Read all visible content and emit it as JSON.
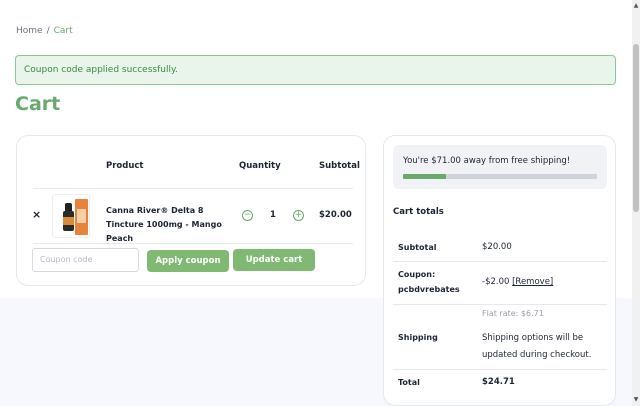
{
  "breadcrumb": {
    "home": "Home",
    "separator": "/",
    "current": "Cart"
  },
  "notice": {
    "message": "Coupon code applied successfully."
  },
  "page_title": "Cart",
  "cart": {
    "headers": {
      "product": "Product",
      "quantity": "Quantity",
      "subtotal": "Subtotal"
    },
    "item": {
      "remove": "×",
      "name": "Canna River® Delta 8 Tincture 1000mg - Mango Peach",
      "qty_minus": "−",
      "quantity": "1",
      "qty_plus": "+",
      "subtotal": "$20.00"
    },
    "coupon_placeholder": "Coupon code",
    "apply_coupon_label": "Apply coupon",
    "update_cart_label": "Update cart"
  },
  "totals": {
    "free_shipping_message": "You're $71.00 away from free shipping!",
    "free_shipping_progress": 0.22,
    "title": "Cart totals",
    "subtotal_label": "Subtotal",
    "subtotal_value": "$20.00",
    "coupon_label": "Coupon: pcbdvrebates",
    "coupon_value": "-$2.00",
    "coupon_remove": "[Remove]",
    "shipping_label": "Shipping",
    "flat_rate": "Flat rate: $6.71",
    "shipping_options": "Shipping options will be updated during checkout.",
    "total_label": "Total",
    "total_value": "$24.71"
  },
  "colors": {
    "accent": "#6aa86e",
    "button": "#7fb972",
    "notice_bg": "#e9f5ea"
  }
}
